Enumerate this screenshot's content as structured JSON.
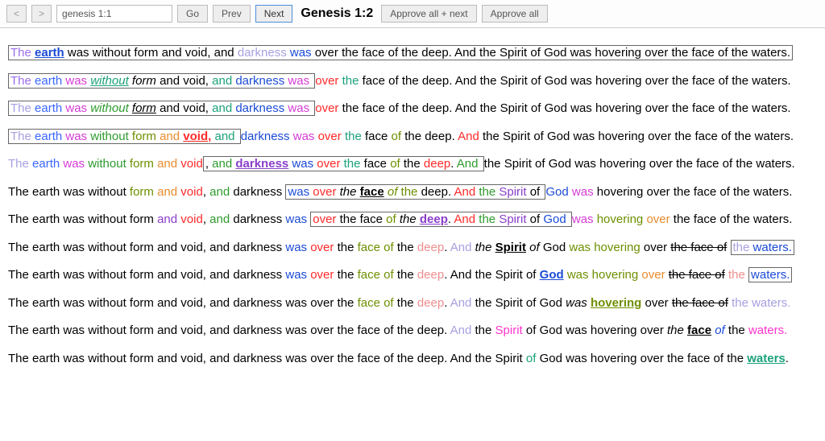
{
  "toolbar": {
    "prev_arrow": "<",
    "next_arrow": ">",
    "search_value": "genesis 1:1",
    "go": "Go",
    "prev": "Prev",
    "next": "Next",
    "title": "Genesis 1:2",
    "approve_next": "Approve all + next",
    "approve_all": "Approve all"
  },
  "palette": {
    "black": "#000000",
    "blue": "#1b4bd6",
    "brightblue": "#3a66ff",
    "purple": "#8a3ec9",
    "violet": "#9a6de8",
    "magenta": "#d63bd6",
    "hotpink": "#ff33cc",
    "red": "#ff2a2a",
    "orange": "#e88b2e",
    "gold": "#b59a00",
    "olive": "#6e8f00",
    "green": "#2e9a2e",
    "teal": "#1aa17a",
    "cyan": "#2aa7cf",
    "steel": "#4a6fa5",
    "lavender": "#a6a0e0",
    "salmon": "#ef8e8e",
    "grey": "#9b9b9b"
  },
  "rows": [
    {
      "box": [
        0,
        8
      ],
      "tokens": [
        {
          "t": "The ",
          "c": "violet"
        },
        {
          "t": "earth",
          "c": "blue",
          "bold": true,
          "ul": true
        },
        {
          "t": " was without form and void, ",
          "c": "black"
        },
        {
          "t": "and ",
          "c": "black"
        },
        {
          "t": "darkness ",
          "c": "lavender"
        },
        {
          "t": "was ",
          "c": "blue"
        },
        {
          "t": "over the face of the deep. And the Spirit of God was hovering over the face of the waters.",
          "c": "black"
        }
      ]
    },
    {
      "box": [
        0,
        8
      ],
      "tokens": [
        {
          "t": "The ",
          "c": "violet"
        },
        {
          "t": "earth ",
          "c": "brightblue"
        },
        {
          "t": "was ",
          "c": "magenta"
        },
        {
          "t": "without",
          "c": "teal",
          "ital": true,
          "ul": true
        },
        {
          "t": " form",
          "c": "black",
          "ital": true
        },
        {
          "t": " and void, ",
          "c": "black"
        },
        {
          "t": "and ",
          "c": "teal"
        },
        {
          "t": "darkness ",
          "c": "blue"
        },
        {
          "t": "was ",
          "c": "magenta"
        },
        {
          "t": "over ",
          "c": "red"
        },
        {
          "t": "the ",
          "c": "teal"
        },
        {
          "t": "face of the deep. And the Spirit of God was hovering over the face of the waters.",
          "c": "black"
        }
      ]
    },
    {
      "box": [
        0,
        8
      ],
      "tokens": [
        {
          "t": "The ",
          "c": "lavender"
        },
        {
          "t": "earth ",
          "c": "brightblue"
        },
        {
          "t": "was ",
          "c": "magenta"
        },
        {
          "t": "without ",
          "c": "green",
          "ital": true
        },
        {
          "t": "form",
          "c": "black",
          "ital": true,
          "ul": true
        },
        {
          "t": " and void, ",
          "c": "black"
        },
        {
          "t": "and ",
          "c": "teal"
        },
        {
          "t": "darkness ",
          "c": "blue"
        },
        {
          "t": "was ",
          "c": "magenta"
        },
        {
          "t": "over ",
          "c": "red"
        },
        {
          "t": "the face of the deep. And the Spirit of God was hovering over the face of the waters.",
          "c": "black"
        }
      ]
    },
    {
      "box": [
        0,
        8
      ],
      "tokens": [
        {
          "t": "The ",
          "c": "lavender"
        },
        {
          "t": "earth ",
          "c": "brightblue"
        },
        {
          "t": "was ",
          "c": "magenta"
        },
        {
          "t": "without ",
          "c": "green"
        },
        {
          "t": "form ",
          "c": "olive"
        },
        {
          "t": "and ",
          "c": "orange"
        },
        {
          "t": "void,",
          "c": "red",
          "bold": true,
          "ul": true
        },
        {
          "t": " ",
          "c": "black"
        },
        {
          "t": "and ",
          "c": "teal"
        },
        {
          "t": "darkness ",
          "c": "blue"
        },
        {
          "t": "was ",
          "c": "magenta"
        },
        {
          "t": "over ",
          "c": "red"
        },
        {
          "t": "the ",
          "c": "teal"
        },
        {
          "t": "face ",
          "c": "black"
        },
        {
          "t": "of ",
          "c": "olive"
        },
        {
          "t": "the ",
          "c": "black"
        },
        {
          "t": "deep. ",
          "c": "black"
        },
        {
          "t": "And ",
          "c": "red"
        },
        {
          "t": "the Spirit of God was hovering over the face of the waters.",
          "c": "black"
        }
      ]
    },
    {
      "box": [
        7,
        18
      ],
      "tokens": [
        {
          "t": "The ",
          "c": "lavender"
        },
        {
          "t": "earth ",
          "c": "brightblue"
        },
        {
          "t": "was ",
          "c": "magenta"
        },
        {
          "t": "without ",
          "c": "green"
        },
        {
          "t": "form ",
          "c": "olive"
        },
        {
          "t": "and ",
          "c": "orange"
        },
        {
          "t": "void",
          "c": "red"
        },
        {
          "t": ", ",
          "c": "black"
        },
        {
          "t": "and ",
          "c": "green"
        },
        {
          "t": "darkness",
          "c": "purple",
          "bold": true,
          "ul": true
        },
        {
          "t": " was ",
          "c": "blue"
        },
        {
          "t": "over ",
          "c": "red"
        },
        {
          "t": "the ",
          "c": "teal"
        },
        {
          "t": "face ",
          "c": "black"
        },
        {
          "t": "of ",
          "c": "olive"
        },
        {
          "t": "the ",
          "c": "black"
        },
        {
          "t": "deep",
          "c": "red"
        },
        {
          "t": ". ",
          "c": "black"
        },
        {
          "t": "And ",
          "c": "green"
        },
        {
          "t": "the ",
          "c": "black"
        },
        {
          "t": "Spirit of God was hovering over the face of the waters.",
          "c": "black"
        }
      ]
    },
    {
      "box": [
        7,
        18
      ],
      "tokens": [
        {
          "t": "The earth was without ",
          "c": "black"
        },
        {
          "t": "form ",
          "c": "olive"
        },
        {
          "t": "and ",
          "c": "orange"
        },
        {
          "t": "void",
          "c": "red"
        },
        {
          "t": ", ",
          "c": "black"
        },
        {
          "t": "and ",
          "c": "green"
        },
        {
          "t": "darkness ",
          "c": "black"
        },
        {
          "t": "was ",
          "c": "blue"
        },
        {
          "t": "over ",
          "c": "red"
        },
        {
          "t": "the ",
          "c": "black",
          "ital": true
        },
        {
          "t": "face",
          "c": "black",
          "bold": true,
          "ul": true
        },
        {
          "t": " of ",
          "c": "olive",
          "ital": true
        },
        {
          "t": "the ",
          "c": "olive"
        },
        {
          "t": "deep",
          "c": "black"
        },
        {
          "t": ". ",
          "c": "black"
        },
        {
          "t": "And ",
          "c": "red"
        },
        {
          "t": "the ",
          "c": "green"
        },
        {
          "t": "Spirit ",
          "c": "purple"
        },
        {
          "t": "of ",
          "c": "black"
        },
        {
          "t": "God ",
          "c": "blue"
        },
        {
          "t": "was ",
          "c": "magenta"
        },
        {
          "t": "hovering over the face of the waters.",
          "c": "black"
        }
      ]
    },
    {
      "box": [
        7,
        18
      ],
      "tokens": [
        {
          "t": "The earth was without form ",
          "c": "black"
        },
        {
          "t": "and ",
          "c": "purple"
        },
        {
          "t": "void",
          "c": "red"
        },
        {
          "t": ", ",
          "c": "black"
        },
        {
          "t": "and ",
          "c": "green"
        },
        {
          "t": "darkness ",
          "c": "black"
        },
        {
          "t": "was ",
          "c": "blue"
        },
        {
          "t": "over ",
          "c": "red"
        },
        {
          "t": "the ",
          "c": "black"
        },
        {
          "t": "face ",
          "c": "black"
        },
        {
          "t": "of ",
          "c": "olive"
        },
        {
          "t": "the ",
          "c": "black",
          "ital": true
        },
        {
          "t": "deep",
          "c": "purple",
          "bold": true,
          "ul": true
        },
        {
          "t": ". ",
          "c": "black"
        },
        {
          "t": "And ",
          "c": "red"
        },
        {
          "t": "the ",
          "c": "green"
        },
        {
          "t": "Spirit ",
          "c": "purple"
        },
        {
          "t": "of ",
          "c": "black"
        },
        {
          "t": "God ",
          "c": "blue"
        },
        {
          "t": "was ",
          "c": "magenta"
        },
        {
          "t": "hovering ",
          "c": "olive"
        },
        {
          "t": "over ",
          "c": "orange"
        },
        {
          "t": "the face of the waters.",
          "c": "black"
        }
      ]
    },
    {
      "box": [
        19,
        33
      ],
      "tokens": [
        {
          "t": "The earth was without form and void, and darkness ",
          "c": "black"
        },
        {
          "t": "was ",
          "c": "blue"
        },
        {
          "t": "over ",
          "c": "red"
        },
        {
          "t": "the ",
          "c": "black"
        },
        {
          "t": "face ",
          "c": "olive"
        },
        {
          "t": "of ",
          "c": "olive"
        },
        {
          "t": "the ",
          "c": "black"
        },
        {
          "t": "deep",
          "c": "salmon"
        },
        {
          "t": ". ",
          "c": "black"
        },
        {
          "t": "And ",
          "c": "lavender"
        },
        {
          "t": "the ",
          "c": "black",
          "ital": true
        },
        {
          "t": "Spirit",
          "c": "black",
          "bold": true,
          "ul": true
        },
        {
          "t": " of ",
          "c": "black",
          "ital": true
        },
        {
          "t": "God ",
          "c": "black"
        },
        {
          "t": "was ",
          "c": "olive"
        },
        {
          "t": "hovering ",
          "c": "olive"
        },
        {
          "t": "over ",
          "c": "black"
        },
        {
          "t": "the face of",
          "c": "black",
          "strike": true
        },
        {
          "t": " ",
          "c": "black"
        },
        {
          "t": "the ",
          "c": "lavender"
        },
        {
          "t": "waters.",
          "c": "blue"
        }
      ]
    },
    {
      "box": [
        19,
        33
      ],
      "tokens": [
        {
          "t": "The earth was without form and void, and darkness ",
          "c": "black"
        },
        {
          "t": "was ",
          "c": "blue"
        },
        {
          "t": "over ",
          "c": "red"
        },
        {
          "t": "the ",
          "c": "black"
        },
        {
          "t": "face ",
          "c": "olive"
        },
        {
          "t": "of ",
          "c": "olive"
        },
        {
          "t": "the ",
          "c": "black"
        },
        {
          "t": "deep",
          "c": "salmon"
        },
        {
          "t": ". And ",
          "c": "black"
        },
        {
          "t": "the ",
          "c": "black"
        },
        {
          "t": "Spirit ",
          "c": "black"
        },
        {
          "t": "of ",
          "c": "black"
        },
        {
          "t": "God",
          "c": "blue",
          "bold": true,
          "ul": true
        },
        {
          "t": " was ",
          "c": "olive"
        },
        {
          "t": "hovering ",
          "c": "olive"
        },
        {
          "t": "over ",
          "c": "orange"
        },
        {
          "t": "the face of",
          "c": "black",
          "strike": true
        },
        {
          "t": " ",
          "c": "black"
        },
        {
          "t": "the ",
          "c": "salmon"
        },
        {
          "t": "waters.",
          "c": "blue"
        }
      ]
    },
    {
      "box": [
        19,
        33
      ],
      "tokens": [
        {
          "t": "The earth was without form and void, and darkness was over the ",
          "c": "black"
        },
        {
          "t": "face ",
          "c": "olive"
        },
        {
          "t": "of ",
          "c": "olive"
        },
        {
          "t": "the ",
          "c": "black"
        },
        {
          "t": "deep",
          "c": "salmon"
        },
        {
          "t": ". ",
          "c": "black"
        },
        {
          "t": "And ",
          "c": "lavender"
        },
        {
          "t": "the Spirit of God ",
          "c": "black"
        },
        {
          "t": "was ",
          "c": "black",
          "ital": true
        },
        {
          "t": "hovering",
          "c": "olive",
          "bold": true,
          "ul": true
        },
        {
          "t": " over ",
          "c": "black"
        },
        {
          "t": "the face of",
          "c": "black",
          "strike": true
        },
        {
          "t": " ",
          "c": "black"
        },
        {
          "t": "the ",
          "c": "lavender"
        },
        {
          "t": "waters.",
          "c": "lavender"
        }
      ]
    },
    {
      "box": [
        19,
        33
      ],
      "tokens": [
        {
          "t": "The earth was without form and void, and darkness was over the face of the deep. ",
          "c": "black"
        },
        {
          "t": "And ",
          "c": "lavender"
        },
        {
          "t": "the ",
          "c": "black"
        },
        {
          "t": "Spirit ",
          "c": "hotpink"
        },
        {
          "t": "of God was hovering over ",
          "c": "black"
        },
        {
          "t": "the ",
          "c": "black",
          "ital": true
        },
        {
          "t": "face",
          "c": "black",
          "bold": true,
          "ul": true
        },
        {
          "t": " of ",
          "c": "blue",
          "ital": true
        },
        {
          "t": "the ",
          "c": "black"
        },
        {
          "t": "waters.",
          "c": "hotpink"
        }
      ]
    },
    {
      "box": [
        21,
        32
      ],
      "tokens": [
        {
          "t": "The earth was without form and void, and darkness was over the face of the deep. And the Spirit ",
          "c": "black"
        },
        {
          "t": "of ",
          "c": "teal"
        },
        {
          "t": "God was hovering over the face of the ",
          "c": "black"
        },
        {
          "t": "waters",
          "c": "teal",
          "bold": true,
          "ul": true
        },
        {
          "t": ".",
          "c": "black"
        }
      ]
    }
  ]
}
